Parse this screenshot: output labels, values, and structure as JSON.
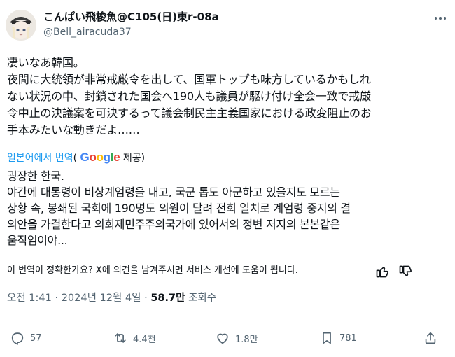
{
  "author": {
    "display_name": "こんぱい飛梭魚@C105(日)東r-08a",
    "handle": "@Bell_airacuda37"
  },
  "tweet": {
    "text": "凄いなあ韓国。\n夜間に大統領が非常戒厳令を出して、国軍トップも味方しているかもしれ\nない状況の中、封鎖された国会へ190人も議員が駆け付け全会一致で戒厳\n令中止の決議案を可決するって議会制民主主義国家における政変阻止のお\n手本みたいな動きだよ……"
  },
  "translation": {
    "link_label": "일본어에서 번역",
    "open_paren": "(",
    "google_word": [
      "G",
      "o",
      "o",
      "g",
      "l",
      "e"
    ],
    "provided_label": "제공)",
    "text": "굉장한 한국.\n야간에 대통령이 비상계엄령을 내고, 국군 톱도 아군하고 있을지도 모르는\n상황 속, 봉쇄된 국회에 190명도 의원이 달려 전회 일치로 계엄령 중지의 결\n의안을 가결한다고 의회제민주주의국가에 있어서의 정변 저지의 본본같은\n움직임이야...",
    "feedback_prompt": "이 번역이 정확한가요? X에 의견을 남겨주시면 서비스 개선에 도움이 됩니다."
  },
  "meta": {
    "time": "오전 1:41",
    "sep": "·",
    "date": "2024년 12월 4일",
    "views_count": "58.7만",
    "views_label": "조회수"
  },
  "actions": {
    "reply_count": "57",
    "repost_count": "4.4천",
    "like_count": "1.8만",
    "bookmark_count": "781"
  },
  "icons": {
    "more": "more-horizontal-icon",
    "thumbs_up": "thumbs-up-icon",
    "thumbs_down": "thumbs-down-icon",
    "reply": "reply-icon",
    "repost": "repost-icon",
    "like": "heart-icon",
    "views": "analytics-icon",
    "bookmark": "bookmark-icon",
    "share": "share-icon"
  },
  "colors": {
    "link": "#1d9bf0",
    "muted": "#536471",
    "text": "#0f1419"
  }
}
